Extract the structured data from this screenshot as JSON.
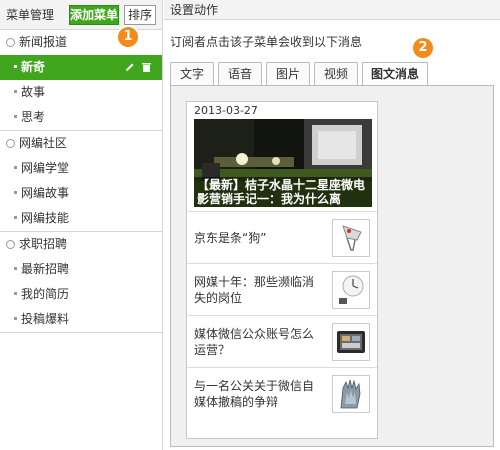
{
  "left_panel": {
    "title": "菜单管理",
    "add_button": "添加菜单",
    "sort_button": "排序",
    "groups": [
      {
        "label": "新闻报道",
        "children": [
          {
            "label": "新奇",
            "active": true
          },
          {
            "label": "故事",
            "active": false
          },
          {
            "label": "思考",
            "active": false
          }
        ]
      },
      {
        "label": "网编社区",
        "children": [
          {
            "label": "网编学堂",
            "active": false
          },
          {
            "label": "网编故事",
            "active": false
          },
          {
            "label": "网编技能",
            "active": false
          }
        ]
      },
      {
        "label": "求职招聘",
        "children": [
          {
            "label": "最新招聘",
            "active": false
          },
          {
            "label": "我的简历",
            "active": false
          },
          {
            "label": "投稿爆料",
            "active": false
          }
        ]
      }
    ]
  },
  "right_panel": {
    "title": "设置动作",
    "hint": "订阅者点击该子菜单会收到以下消息",
    "tabs": [
      {
        "label": "文字",
        "active": false
      },
      {
        "label": "语音",
        "active": false
      },
      {
        "label": "图片",
        "active": false
      },
      {
        "label": "视频",
        "active": false
      },
      {
        "label": "图文消息",
        "active": true
      }
    ]
  },
  "news": {
    "date": "2013-03-27",
    "headline": "【最新】桔子水晶十二星座微电影营销手记一：我为什么离",
    "items": [
      {
        "title": "京东是条“狗”",
        "thumb": "dog-thumb"
      },
      {
        "title": "网媒十年：那些濒临消失的岗位",
        "thumb": "clock-thumb"
      },
      {
        "title": "媒体微信公众账号怎么运营？",
        "thumb": "tablet-thumb"
      },
      {
        "title": "与一名公关关于微信自媒体撤稿的争辩",
        "thumb": "hands-thumb"
      }
    ]
  },
  "badges": [
    "1",
    "2"
  ],
  "colors": {
    "accent_green": "#3fa61e",
    "badge_orange": "#f08b1c",
    "panel_bg": "#f0f0f0"
  }
}
